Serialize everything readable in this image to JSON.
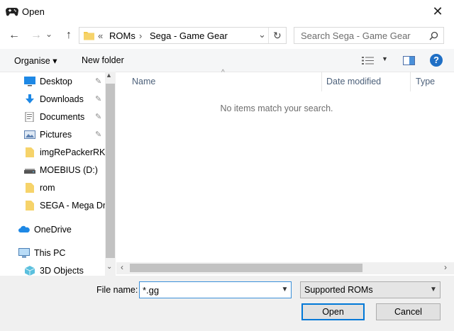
{
  "window": {
    "title": "Open",
    "close_glyph": "✕"
  },
  "nav": {
    "back_glyph": "←",
    "forward_glyph": "→",
    "dropdown_glyph": "⌄",
    "up_glyph": "↑"
  },
  "address": {
    "overflow": "«",
    "crumbs": [
      "ROMs",
      "Sega - Game Gear"
    ],
    "separator": "›",
    "dropdown_glyph": "⌄",
    "refresh_glyph": "↻"
  },
  "search": {
    "placeholder": "Search Sega - Game Gear",
    "icon": "search-icon"
  },
  "toolbar": {
    "organise_label": "Organise ▾",
    "new_folder_label": "New folder",
    "help_glyph": "?"
  },
  "sidebar": {
    "items": [
      {
        "label": "Desktop",
        "icon": "desktop-icon",
        "pinned": true
      },
      {
        "label": "Downloads",
        "icon": "download-icon",
        "pinned": true
      },
      {
        "label": "Documents",
        "icon": "documents-icon",
        "pinned": true
      },
      {
        "label": "Pictures",
        "icon": "pictures-icon",
        "pinned": true
      },
      {
        "label": "imgRePackerRK_",
        "icon": "folder-icon"
      },
      {
        "label": "MOEBIUS (D:)",
        "icon": "drive-icon"
      },
      {
        "label": "rom",
        "icon": "folder-icon"
      },
      {
        "label": "SEGA - Mega Dri",
        "icon": "folder-icon"
      },
      {
        "label": "OneDrive",
        "icon": "cloud-icon"
      },
      {
        "label": "This PC",
        "icon": "pc-icon"
      },
      {
        "label": "3D Objects",
        "icon": "3d-objects-icon"
      }
    ],
    "pin_glyph": "📌"
  },
  "columns": [
    "Name",
    "Date modified",
    "Type"
  ],
  "content": {
    "empty_message": "No items match your search."
  },
  "footer": {
    "file_name_label": "File name:",
    "file_name_value": "*.gg",
    "filter_value": "Supported ROMs",
    "open_label": "Open",
    "cancel_label": "Cancel"
  },
  "colors": {
    "accent": "#0078d7",
    "folder": "#f2c94c"
  }
}
